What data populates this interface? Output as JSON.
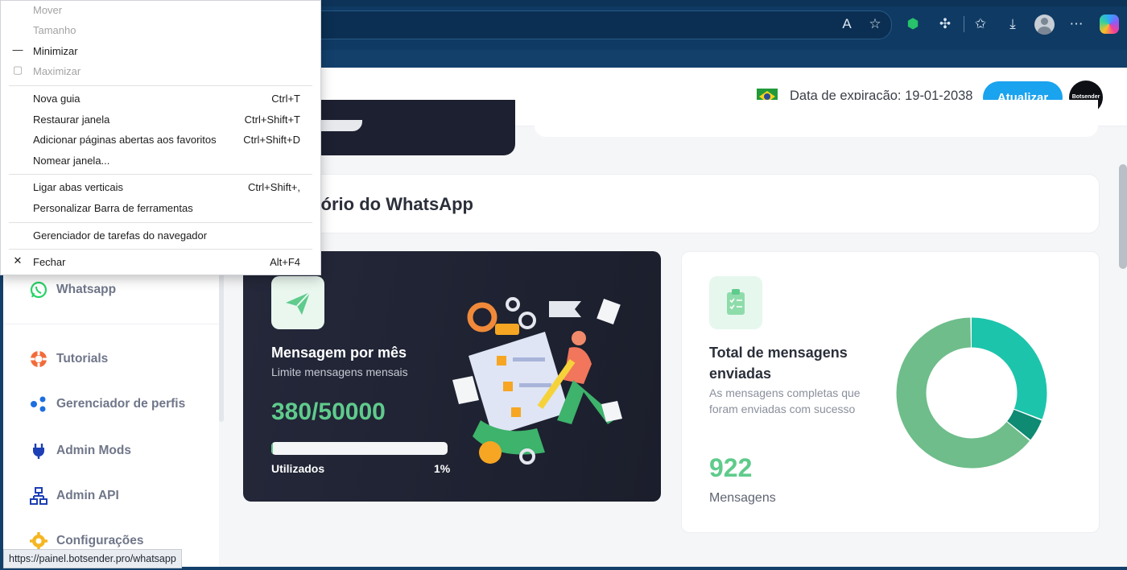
{
  "browser": {
    "status_url": "https://painel.botsender.pro/whatsapp"
  },
  "header": {
    "expiration_text": "Data de expiração: 19-01-2038",
    "update_button": "Atualizar",
    "logo_text": "Botsender"
  },
  "report": {
    "title_visible": "atório do WhatsApp"
  },
  "sidebar": {
    "items": [
      {
        "label": "Whatsapp",
        "icon": "whatsapp-icon"
      },
      {
        "label": "Tutorials",
        "icon": "lifebuoy-icon"
      },
      {
        "label": "Gerenciador de perfis",
        "icon": "share-nodes-icon"
      },
      {
        "label": "Admin Mods",
        "icon": "plug-icon"
      },
      {
        "label": "Admin API",
        "icon": "sitemap-icon"
      },
      {
        "label": "Configurações",
        "icon": "gear-icon"
      }
    ]
  },
  "monthly_card": {
    "title": "Mensagem por mês",
    "subtitle": "Limite mensagens mensais",
    "count": "380/50000",
    "used_label": "Utilizados",
    "percent_label": "1%",
    "progress_fraction": 0.01
  },
  "total_card": {
    "title": "Total de mensagens enviadas",
    "subtitle": "As mensagens completas que foram enviadas com sucesso",
    "count": "922",
    "unit": "Mensagens"
  },
  "donut": {
    "segments": [
      {
        "fraction": 0.31,
        "color": "#1dc4ac"
      },
      {
        "fraction": 0.05,
        "color": "#0f8a73"
      },
      {
        "fraction": 0.64,
        "color": "#6ebd8a"
      }
    ]
  },
  "context_menu": {
    "items": [
      {
        "label": "Mover",
        "shortcut": "",
        "disabled": true,
        "icon": ""
      },
      {
        "label": "Tamanho",
        "shortcut": "",
        "disabled": true,
        "icon": ""
      },
      {
        "label": "Minimizar",
        "shortcut": "",
        "disabled": false,
        "icon": "—"
      },
      {
        "label": "Maximizar",
        "shortcut": "",
        "disabled": true,
        "icon": "▢"
      },
      {
        "label": "Nova guia",
        "shortcut": "Ctrl+T",
        "disabled": false,
        "icon": ""
      },
      {
        "label": "Restaurar janela",
        "shortcut": "Ctrl+Shift+T",
        "disabled": false,
        "icon": ""
      },
      {
        "label": "Adicionar páginas abertas aos favoritos",
        "shortcut": "Ctrl+Shift+D",
        "disabled": false,
        "icon": ""
      },
      {
        "label": "Nomear janela...",
        "shortcut": "",
        "disabled": false,
        "icon": ""
      },
      {
        "label": "Ligar abas verticais",
        "shortcut": "Ctrl+Shift+,",
        "disabled": false,
        "icon": ""
      },
      {
        "label": "Personalizar Barra de ferramentas",
        "shortcut": "",
        "disabled": false,
        "icon": ""
      },
      {
        "label": "Gerenciador de tarefas do navegador",
        "shortcut": "",
        "disabled": false,
        "icon": ""
      },
      {
        "label": "Fechar",
        "shortcut": "Alt+F4",
        "disabled": false,
        "icon": "✕"
      }
    ]
  }
}
